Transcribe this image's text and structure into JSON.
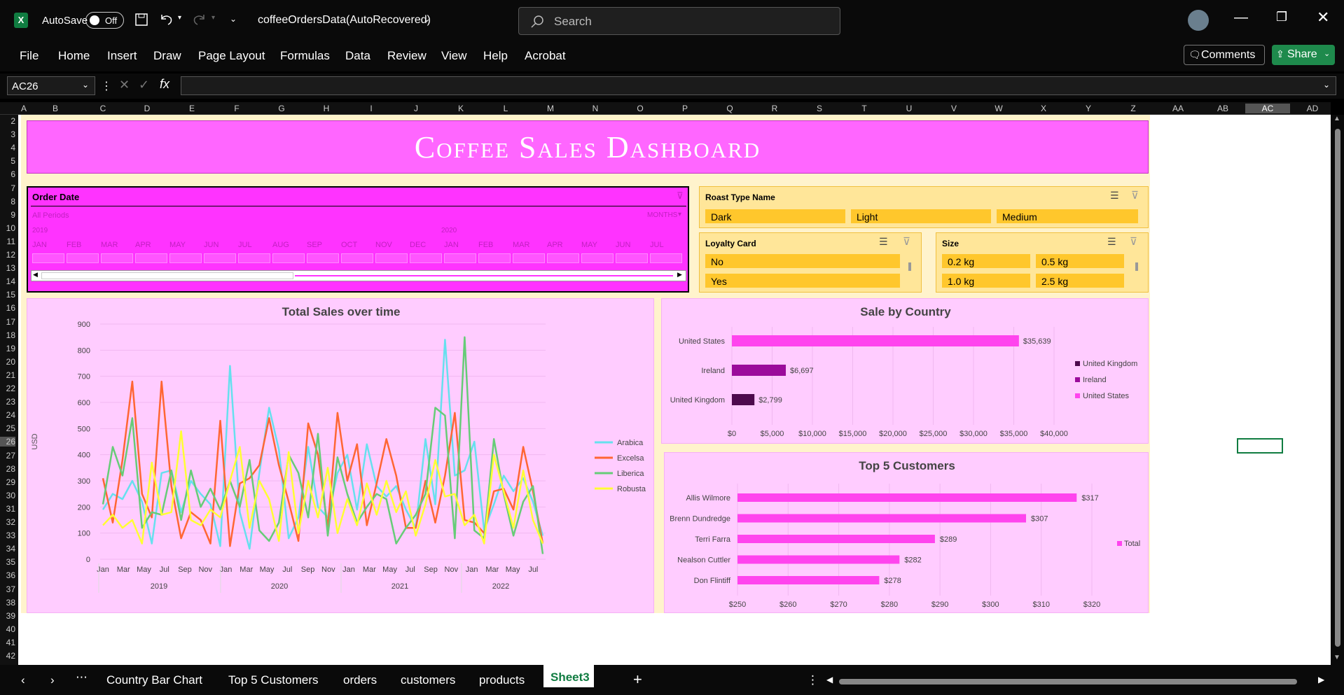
{
  "titlebar": {
    "autosave_label": "AutoSave",
    "autosave_state": "Off",
    "filename": "coffeeOrdersData(AutoRecovered)",
    "search_placeholder": "Search"
  },
  "menu": [
    "File",
    "Home",
    "Insert",
    "Draw",
    "Page Layout",
    "Formulas",
    "Data",
    "Review",
    "View",
    "Help",
    "Acrobat"
  ],
  "comments_label": "Comments",
  "share_label": "Share",
  "namebox": "AC26",
  "columns": [
    "A",
    "B",
    "C",
    "D",
    "E",
    "F",
    "G",
    "H",
    "I",
    "J",
    "K",
    "L",
    "M",
    "N",
    "O",
    "P",
    "Q",
    "R",
    "S",
    "T",
    "U",
    "V",
    "W",
    "X",
    "Y",
    "Z",
    "AA",
    "AB",
    "AC",
    "AD"
  ],
  "rows": [
    "2",
    "3",
    "4",
    "5",
    "6",
    "7",
    "8",
    "9",
    "10",
    "11",
    "12",
    "13",
    "14",
    "15",
    "16",
    "17",
    "18",
    "19",
    "20",
    "21",
    "22",
    "23",
    "24",
    "25",
    "26",
    "27",
    "28",
    "29",
    "30",
    "31",
    "32",
    "33",
    "34",
    "35",
    "36",
    "37",
    "38",
    "39",
    "40",
    "41",
    "42"
  ],
  "dashboard_title": "Coffee Sales Dashboard",
  "date_slicer": {
    "title": "Order Date",
    "periods_label": "All Periods",
    "level_label": "MONTHS",
    "year1": "2019",
    "year2": "2020",
    "months": [
      "JAN",
      "FEB",
      "MAR",
      "APR",
      "MAY",
      "JUN",
      "JUL",
      "AUG",
      "SEP",
      "OCT",
      "NOV",
      "DEC",
      "JAN",
      "FEB",
      "MAR",
      "APR",
      "MAY",
      "JUN",
      "JUL"
    ]
  },
  "roast_slicer": {
    "title": "Roast Type Name",
    "items": [
      "Dark",
      "Light",
      "Medium"
    ]
  },
  "loyalty_slicer": {
    "title": "Loyalty Card",
    "items": [
      "No",
      "Yes"
    ]
  },
  "size_slicer": {
    "title": "Size",
    "items": [
      "0.2 kg",
      "0.5 kg",
      "1.0 kg",
      "2.5 kg"
    ]
  },
  "chart_data": [
    {
      "type": "line",
      "title": "Total Sales over time",
      "ylabel": "USD",
      "ylim": [
        0,
        900
      ],
      "yticks": [
        "0",
        "100",
        "200",
        "300",
        "400",
        "500",
        "600",
        "700",
        "800",
        "900"
      ],
      "x_month_labels": [
        "Jan",
        "Mar",
        "May",
        "Jul",
        "Sep",
        "Nov",
        "Jan",
        "Mar",
        "May",
        "Jul",
        "Sep",
        "Nov",
        "Jan",
        "Mar",
        "May",
        "Jul",
        "Sep",
        "Nov",
        "Jan",
        "Mar",
        "May",
        "Jul"
      ],
      "x_years": [
        "2019",
        "2020",
        "2021",
        "2022"
      ],
      "series": [
        {
          "name": "Arabica",
          "color": "#66e0ee",
          "values": [
            190,
            250,
            230,
            300,
            220,
            60,
            330,
            340,
            180,
            300,
            250,
            210,
            50,
            740,
            180,
            40,
            330,
            580,
            420,
            80,
            160,
            430,
            200,
            160,
            330,
            400,
            190,
            440,
            280,
            240,
            280,
            190,
            120,
            460,
            210,
            840,
            320,
            340,
            450,
            110,
            210,
            320,
            260,
            310,
            220,
            90
          ]
        },
        {
          "name": "Excelsa",
          "color": "#ff6633",
          "values": [
            310,
            140,
            380,
            680,
            250,
            160,
            680,
            280,
            80,
            180,
            150,
            60,
            530,
            50,
            290,
            310,
            360,
            540,
            360,
            220,
            70,
            520,
            400,
            120,
            560,
            300,
            440,
            130,
            290,
            460,
            320,
            120,
            120,
            300,
            140,
            320,
            560,
            150,
            140,
            100,
            260,
            270,
            190,
            430,
            260,
            60
          ]
        },
        {
          "name": "Liberica",
          "color": "#66cc77",
          "values": [
            210,
            430,
            320,
            540,
            120,
            180,
            170,
            340,
            150,
            340,
            200,
            270,
            190,
            300,
            200,
            380,
            110,
            70,
            140,
            400,
            330,
            160,
            480,
            90,
            390,
            250,
            140,
            200,
            250,
            230,
            60,
            120,
            170,
            250,
            580,
            550,
            80,
            850,
            110,
            80,
            460,
            250,
            90,
            220,
            280,
            20
          ]
        },
        {
          "name": "Robusta",
          "color": "#ffff33",
          "values": [
            130,
            170,
            120,
            150,
            60,
            370,
            170,
            180,
            490,
            150,
            130,
            190,
            160,
            300,
            430,
            120,
            300,
            230,
            70,
            410,
            100,
            300,
            160,
            350,
            100,
            230,
            130,
            290,
            170,
            300,
            180,
            260,
            90,
            210,
            380,
            240,
            250,
            130,
            170,
            60,
            400,
            260,
            120,
            340,
            150,
            60
          ]
        }
      ]
    },
    {
      "type": "bar",
      "title": "Sale by Country",
      "categories": [
        "United States",
        "Ireland",
        "United Kingdom"
      ],
      "values": [
        35639,
        6697,
        2799
      ],
      "data_labels": [
        "$35,639",
        "$6,697",
        "$2,799"
      ],
      "colors": [
        "#ff44ee",
        "#9b0b9b",
        "#4d0a4d"
      ],
      "xticks": [
        "$0",
        "$5,000",
        "$10,000",
        "$15,000",
        "$20,000",
        "$25,000",
        "$30,000",
        "$35,000",
        "$40,000"
      ],
      "xlim": [
        0,
        40000
      ],
      "legend": [
        "United Kingdom",
        "Ireland",
        "United States"
      ]
    },
    {
      "type": "bar",
      "title": "Top 5 Customers",
      "categories": [
        "Allis Wilmore",
        "Brenn Dundredge",
        "Terri Farra",
        "Nealson Cuttler",
        "Don Flintiff"
      ],
      "values": [
        317,
        307,
        289,
        282,
        278
      ],
      "data_labels": [
        "$317",
        "$307",
        "$289",
        "$282",
        "$278"
      ],
      "xticks": [
        "$250",
        "$260",
        "$270",
        "$280",
        "$290",
        "$300",
        "$310",
        "$320"
      ],
      "xlim": [
        250,
        320
      ],
      "legend": [
        "Total"
      ],
      "color": "#ff44ee"
    }
  ],
  "tabs": [
    "Country Bar Chart",
    "Top 5 Customers",
    "orders",
    "customers",
    "products",
    "Sheet3"
  ],
  "active_tab": "Sheet3"
}
